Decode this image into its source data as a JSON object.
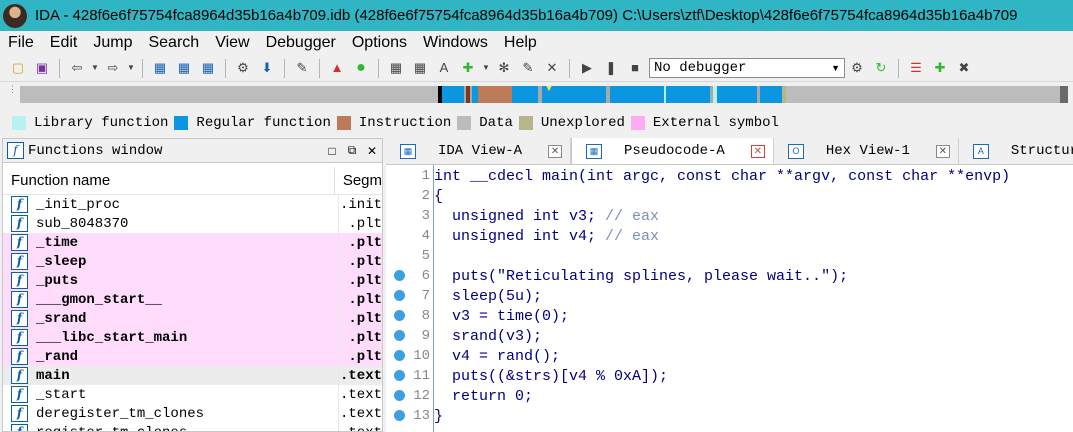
{
  "window": {
    "title": "IDA - 428f6e6f75754fca8964d35b16a4b709.idb (428f6e6f75754fca8964d35b16a4b709) C:\\Users\\ztf\\Desktop\\428f6e6f75754fca8964d35b16a4b709"
  },
  "menu": [
    "File",
    "Edit",
    "Jump",
    "Search",
    "View",
    "Debugger",
    "Options",
    "Windows",
    "Help"
  ],
  "toolbar": {
    "debugger_select": "No debugger"
  },
  "legend": [
    {
      "label": "Library function",
      "color": "#b7f2f2"
    },
    {
      "label": "Regular function",
      "color": "#0a96e0"
    },
    {
      "label": "Instruction",
      "color": "#bd7b5a"
    },
    {
      "label": "Data",
      "color": "#bcbcbc"
    },
    {
      "label": "Unexplored",
      "color": "#b7b58a"
    },
    {
      "label": "External symbol",
      "color": "#ffaaf2"
    }
  ],
  "functions_window": {
    "title": "Functions window",
    "col_name": "Function name",
    "col_segment": "Segm",
    "rows": [
      {
        "name": "_init_proc",
        "segment": ".init",
        "style": "normal"
      },
      {
        "name": "sub_8048370",
        "segment": ".plt",
        "style": "normal"
      },
      {
        "name": "_time",
        "segment": ".plt",
        "style": "ext"
      },
      {
        "name": "_sleep",
        "segment": ".plt",
        "style": "ext"
      },
      {
        "name": "_puts",
        "segment": ".plt",
        "style": "ext"
      },
      {
        "name": "___gmon_start__",
        "segment": ".plt",
        "style": "ext"
      },
      {
        "name": "_srand",
        "segment": ".plt",
        "style": "ext"
      },
      {
        "name": "___libc_start_main",
        "segment": ".plt",
        "style": "ext"
      },
      {
        "name": "_rand",
        "segment": ".plt",
        "style": "ext"
      },
      {
        "name": "main",
        "segment": ".text",
        "style": "sel"
      },
      {
        "name": "_start",
        "segment": ".text",
        "style": "normal"
      },
      {
        "name": "deregister_tm_clones",
        "segment": ".text",
        "style": "normal"
      },
      {
        "name": "register_tm_clones",
        "segment": ".text",
        "style": "normal"
      }
    ]
  },
  "tabs": [
    {
      "label": "IDA View-A",
      "icon": "graph-view-icon",
      "active": false
    },
    {
      "label": "Pseudocode-A",
      "icon": "pseudocode-icon",
      "active": true
    },
    {
      "label": "Hex View-1",
      "icon": "hex-view-icon",
      "active": false
    },
    {
      "label": "Structures",
      "icon": "structures-icon",
      "active": false
    }
  ],
  "pseudocode": [
    {
      "num": "1",
      "bp": false,
      "text": "int __cdecl main(int argc, const char **argv, const char **envp)"
    },
    {
      "num": "2",
      "bp": false,
      "text": "{"
    },
    {
      "num": "3",
      "bp": false,
      "text": "  unsigned int v3; ",
      "comment": "// eax"
    },
    {
      "num": "4",
      "bp": false,
      "text": "  unsigned int v4; ",
      "comment": "// eax"
    },
    {
      "num": "5",
      "bp": false,
      "text": ""
    },
    {
      "num": "6",
      "bp": true,
      "text": "  puts(\"Reticulating splines, please wait..\");"
    },
    {
      "num": "7",
      "bp": true,
      "text": "  sleep(5u);"
    },
    {
      "num": "8",
      "bp": true,
      "text": "  v3 = time(0);"
    },
    {
      "num": "9",
      "bp": true,
      "text": "  srand(v3);"
    },
    {
      "num": "10",
      "bp": true,
      "text": "  v4 = rand();"
    },
    {
      "num": "11",
      "bp": true,
      "text": "  puts((&strs)[v4 % 0xA]);"
    },
    {
      "num": "12",
      "bp": true,
      "text": "  return 0;"
    },
    {
      "num": "13",
      "bp": true,
      "text": "}"
    }
  ]
}
